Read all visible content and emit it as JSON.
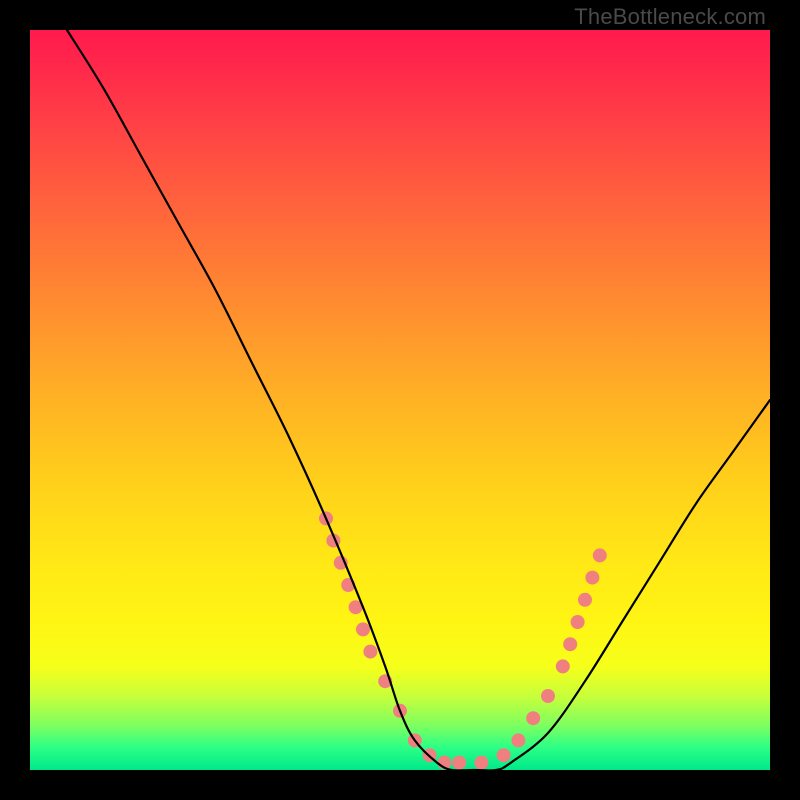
{
  "watermark": "TheBottleneck.com",
  "chart_data": {
    "type": "line",
    "title": "",
    "xlabel": "",
    "ylabel": "",
    "xlim": [
      0,
      100
    ],
    "ylim": [
      0,
      100
    ],
    "grid": false,
    "legend": false,
    "series": [
      {
        "name": "bottleneck-curve",
        "color": "#000000",
        "x": [
          5,
          10,
          15,
          20,
          25,
          30,
          35,
          40,
          45,
          48,
          50,
          52,
          55,
          57,
          60,
          63,
          65,
          70,
          75,
          80,
          85,
          90,
          95,
          100
        ],
        "y": [
          100,
          92,
          83,
          74,
          65,
          55,
          45,
          34,
          22,
          14,
          8,
          4,
          1,
          0,
          0,
          0,
          1,
          5,
          12,
          20,
          28,
          36,
          43,
          50
        ]
      }
    ],
    "markers": {
      "name": "highlight-dots",
      "color": "#f08080",
      "radius_px": 7,
      "points": [
        {
          "x": 40,
          "y": 34
        },
        {
          "x": 41,
          "y": 31
        },
        {
          "x": 42,
          "y": 28
        },
        {
          "x": 43,
          "y": 25
        },
        {
          "x": 44,
          "y": 22
        },
        {
          "x": 45,
          "y": 19
        },
        {
          "x": 46,
          "y": 16
        },
        {
          "x": 48,
          "y": 12
        },
        {
          "x": 50,
          "y": 8
        },
        {
          "x": 52,
          "y": 4
        },
        {
          "x": 54,
          "y": 2
        },
        {
          "x": 56,
          "y": 1
        },
        {
          "x": 58,
          "y": 1
        },
        {
          "x": 61,
          "y": 1
        },
        {
          "x": 64,
          "y": 2
        },
        {
          "x": 66,
          "y": 4
        },
        {
          "x": 68,
          "y": 7
        },
        {
          "x": 70,
          "y": 10
        },
        {
          "x": 72,
          "y": 14
        },
        {
          "x": 73,
          "y": 17
        },
        {
          "x": 74,
          "y": 20
        },
        {
          "x": 75,
          "y": 23
        },
        {
          "x": 76,
          "y": 26
        },
        {
          "x": 77,
          "y": 29
        }
      ]
    }
  }
}
